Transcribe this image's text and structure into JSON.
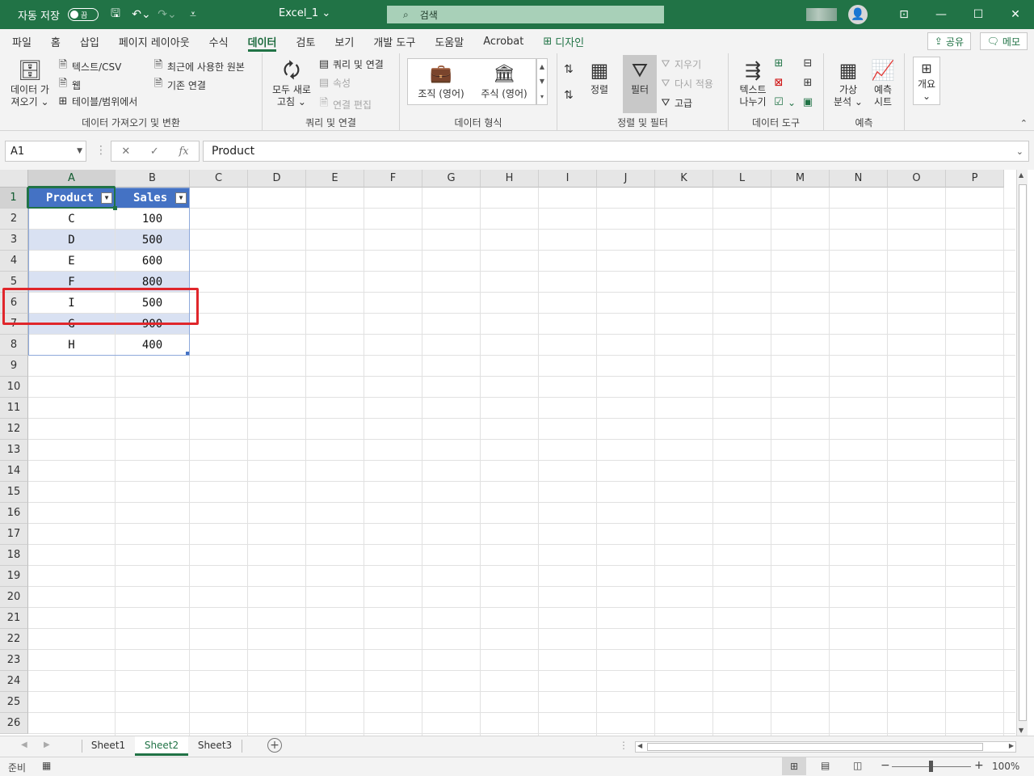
{
  "titlebar": {
    "autosave_label": "자동 저장",
    "autosave_state": "끔",
    "file_title": "Excel_1",
    "search_placeholder": "검색"
  },
  "tabs": [
    "파일",
    "홈",
    "삽입",
    "페이지 레이아웃",
    "수식",
    "데이터",
    "검토",
    "보기",
    "개발 도구",
    "도움말",
    "Acrobat",
    "디자인"
  ],
  "active_tab": "데이터",
  "share_label": "공유",
  "memo_label": "메모",
  "ribbon": {
    "get_data": {
      "big_label_1": "데이터 가",
      "big_label_2": "져오기",
      "text_csv": "텍스트/CSV",
      "web": "웹",
      "table_range": "테이블/범위에서",
      "recent_sources": "최근에 사용한 원본",
      "existing_conn": "기존 연결",
      "group_label": "데이터 가져오기 및 변환"
    },
    "queries": {
      "refresh_1": "모두 새로",
      "refresh_2": "고침",
      "queries_conn": "쿼리 및 연결",
      "properties": "속성",
      "edit_links": "연결 편집",
      "group_label": "쿼리 및 연결"
    },
    "data_types": {
      "org": "조직 (영어)",
      "stocks": "주식 (영어)",
      "group_label": "데이터 형식"
    },
    "sort_filter": {
      "sort": "정렬",
      "filter": "필터",
      "clear": "지우기",
      "reapply": "다시 적용",
      "advanced": "고급",
      "group_label": "정렬 및 필터"
    },
    "data_tools": {
      "text_split_1": "텍스트",
      "text_split_2": "나누기",
      "group_label": "데이터 도구"
    },
    "forecast": {
      "whatif_1": "가상",
      "whatif_2": "분석",
      "forecast_1": "예측",
      "forecast_2": "시트",
      "group_label": "예측"
    },
    "outline": {
      "label": "개요"
    }
  },
  "formula_bar": {
    "name_box": "A1",
    "formula": "Product"
  },
  "columns": [
    "A",
    "B",
    "C",
    "D",
    "E",
    "F",
    "G",
    "H",
    "I",
    "J",
    "K",
    "L",
    "M",
    "N",
    "O",
    "P"
  ],
  "rows": [
    "1",
    "2",
    "3",
    "4",
    "5",
    "6",
    "7",
    "8",
    "9",
    "10",
    "11",
    "12",
    "13",
    "14",
    "15",
    "16",
    "17",
    "18",
    "19",
    "20",
    "21",
    "22",
    "23",
    "24",
    "25",
    "26"
  ],
  "table": {
    "headers": [
      "Product",
      "Sales"
    ],
    "rows": [
      [
        "C",
        "100"
      ],
      [
        "D",
        "500"
      ],
      [
        "E",
        "600"
      ],
      [
        "F",
        "800"
      ],
      [
        "I",
        "500"
      ],
      [
        "G",
        "900"
      ],
      [
        "H",
        "400"
      ]
    ]
  },
  "sheets": [
    "Sheet1",
    "Sheet2",
    "Sheet3"
  ],
  "active_sheet": "Sheet2",
  "status": {
    "ready": "준비",
    "zoom": "100%"
  },
  "colors": {
    "excel_green": "#217346",
    "table_header": "#4472c4",
    "table_band": "#d9e1f2",
    "highlight_red": "#e0262b"
  }
}
